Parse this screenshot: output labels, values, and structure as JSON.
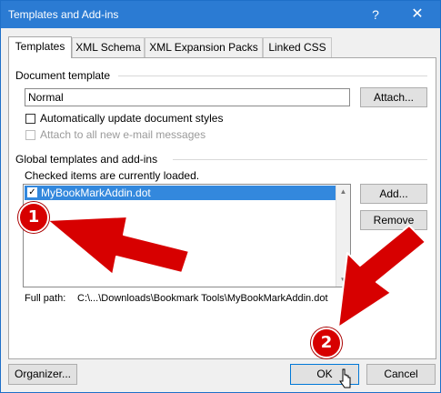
{
  "window": {
    "title": "Templates and Add-ins",
    "help_glyph": "?",
    "close_glyph": "✕"
  },
  "tabs": [
    {
      "label": "Templates"
    },
    {
      "label": "XML Schema"
    },
    {
      "label": "XML Expansion Packs"
    },
    {
      "label": "Linked CSS"
    }
  ],
  "document_template": {
    "section_label": "Document template",
    "value": "Normal",
    "attach_label": "Attach...",
    "auto_update_label": "Automatically update document styles",
    "attach_email_label": "Attach to all new e-mail messages"
  },
  "global": {
    "section_label": "Global templates and add-ins",
    "hint": "Checked items are currently loaded.",
    "items": [
      {
        "label": "MyBookMarkAddin.dot",
        "checked": true
      }
    ],
    "add_label": "Add...",
    "remove_label": "Remove",
    "full_path_label": "Full path:",
    "full_path_value": "C:\\...\\Downloads\\Bookmark Tools\\MyBookMarkAddin.dot"
  },
  "footer": {
    "organizer_label": "Organizer...",
    "ok_label": "OK",
    "cancel_label": "Cancel"
  },
  "annotations": [
    {
      "number": "1"
    },
    {
      "number": "2"
    }
  ],
  "colors": {
    "title_bar": "#2b7bd3",
    "selection": "#3388dd",
    "annotation_red": "#d70000"
  }
}
